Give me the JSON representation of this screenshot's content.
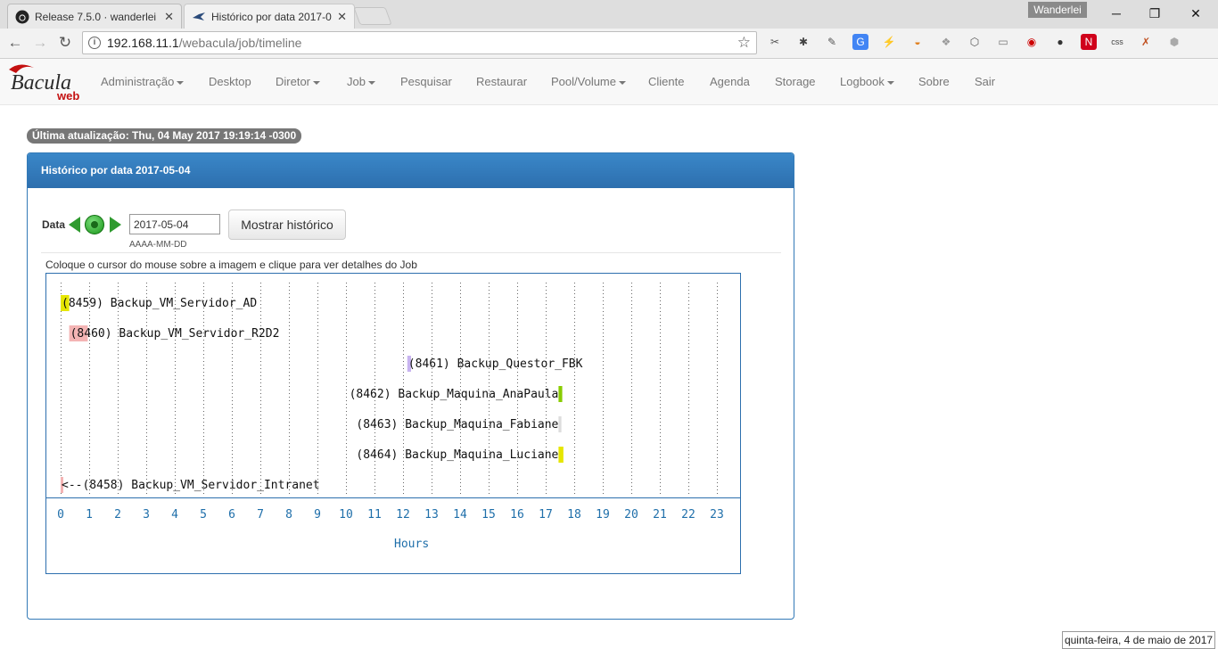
{
  "browser": {
    "tabs": [
      {
        "title": "Release 7.5.0 · wanderlei",
        "icon": "github-icon",
        "active": false
      },
      {
        "title": "Histórico por data 2017-0",
        "icon": "bacula-bird-icon",
        "active": true
      }
    ],
    "profile_name": "Wanderlei",
    "url_host": "192.168.11.1",
    "url_path": "/webacula/job/timeline",
    "extensions": [
      {
        "name": "pin-icon",
        "glyph": "✂",
        "color": "#555"
      },
      {
        "name": "bug-icon",
        "glyph": "✱",
        "color": "#444"
      },
      {
        "name": "eyedropper-icon",
        "glyph": "✎",
        "color": "#555"
      },
      {
        "name": "translate-icon",
        "glyph": "G",
        "color": "#ffffff",
        "bg": "#4285f4"
      },
      {
        "name": "lightning-icon",
        "glyph": "⚡",
        "color": "#333"
      },
      {
        "name": "bowl-icon",
        "glyph": "◒",
        "color": "#e08020"
      },
      {
        "name": "dropbox-icon",
        "glyph": "❖",
        "color": "#999"
      },
      {
        "name": "hexagon-icon",
        "glyph": "⬡",
        "color": "#555"
      },
      {
        "name": "window-icon",
        "glyph": "▭",
        "color": "#777"
      },
      {
        "name": "lastpass-icon",
        "glyph": "◉",
        "color": "#c00"
      },
      {
        "name": "bulb-icon",
        "glyph": "●",
        "color": "#333"
      },
      {
        "name": "n-icon",
        "glyph": "N",
        "color": "#ffffff",
        "bg": "#d0021b"
      },
      {
        "name": "css-icon",
        "glyph": "css",
        "color": "#444"
      },
      {
        "name": "tools-icon",
        "glyph": "✗",
        "color": "#c05020"
      },
      {
        "name": "cube-icon",
        "glyph": "⬢",
        "color": "#aaa"
      }
    ]
  },
  "app": {
    "logo_text": "Bacula",
    "logo_sub": "web",
    "nav": [
      {
        "label": "Administração",
        "dropdown": true
      },
      {
        "label": "Desktop",
        "dropdown": false
      },
      {
        "label": "Diretor",
        "dropdown": true
      },
      {
        "label": "Job",
        "dropdown": true
      },
      {
        "label": "Pesquisar",
        "dropdown": false
      },
      {
        "label": "Restaurar",
        "dropdown": false
      },
      {
        "label": "Pool/Volume",
        "dropdown": true
      },
      {
        "label": "Cliente",
        "dropdown": false
      },
      {
        "label": "Agenda",
        "dropdown": false
      },
      {
        "label": "Storage",
        "dropdown": false
      },
      {
        "label": "Logbook",
        "dropdown": true
      },
      {
        "label": "Sobre",
        "dropdown": false
      },
      {
        "label": "Sair",
        "dropdown": false
      }
    ]
  },
  "content": {
    "last_update": "Última atualização: Thu, 04 May 2017 19:19:14 -0300",
    "panel_title": "Histórico por data 2017-05-04",
    "date_label": "Data",
    "date_value": "2017-05-04",
    "date_format_hint": "AAAA-MM-DD",
    "show_button": "Mostrar histórico",
    "instruction": "Coloque o cursor do mouse sobre a imagem e clique para ver detalhes do Job"
  },
  "timeline": {
    "x_label": "Hours",
    "hours": [
      "0",
      "1",
      "2",
      "3",
      "4",
      "5",
      "6",
      "7",
      "8",
      "9",
      "10",
      "11",
      "12",
      "13",
      "14",
      "15",
      "16",
      "17",
      "18",
      "19",
      "20",
      "21",
      "22",
      "23"
    ],
    "jobs": [
      {
        "label": "(8459) Backup_VM_Servidor_AD",
        "start_hour": 0.0,
        "end_hour": 0.3,
        "color": "#e6e600",
        "label_side": "right"
      },
      {
        "label": "(8460) Backup_VM_Servidor_R2D2",
        "start_hour": 0.3,
        "end_hour": 0.95,
        "color": "#f4b4b4",
        "label_side": "right"
      },
      {
        "label": "(8461) Backup_Questor_FBK",
        "start_hour": 12.15,
        "end_hour": 12.28,
        "color": "#c8b4f0",
        "label_side": "right"
      },
      {
        "label": "(8462) Backup_Maquina_AnaPaula",
        "start_hour": 17.45,
        "end_hour": 17.58,
        "color": "#88cc00",
        "label_side": "left"
      },
      {
        "label": "(8463) Backup_Maquina_Fabiane",
        "start_hour": 17.45,
        "end_hour": 17.55,
        "color": "#dddddd",
        "label_side": "left"
      },
      {
        "label": "(8464) Backup_Maquina_Luciane",
        "start_hour": 17.45,
        "end_hour": 17.62,
        "color": "#e6e600",
        "label_side": "left"
      },
      {
        "label": "<--(8458) Backup_VM_Servidor_Intranet",
        "start_hour": 0.0,
        "end_hour": 0.07,
        "color": "#f4b4b4",
        "label_side": "right"
      }
    ]
  },
  "os": {
    "date_tooltip": "quinta-feira, 4 de maio de 2017"
  }
}
